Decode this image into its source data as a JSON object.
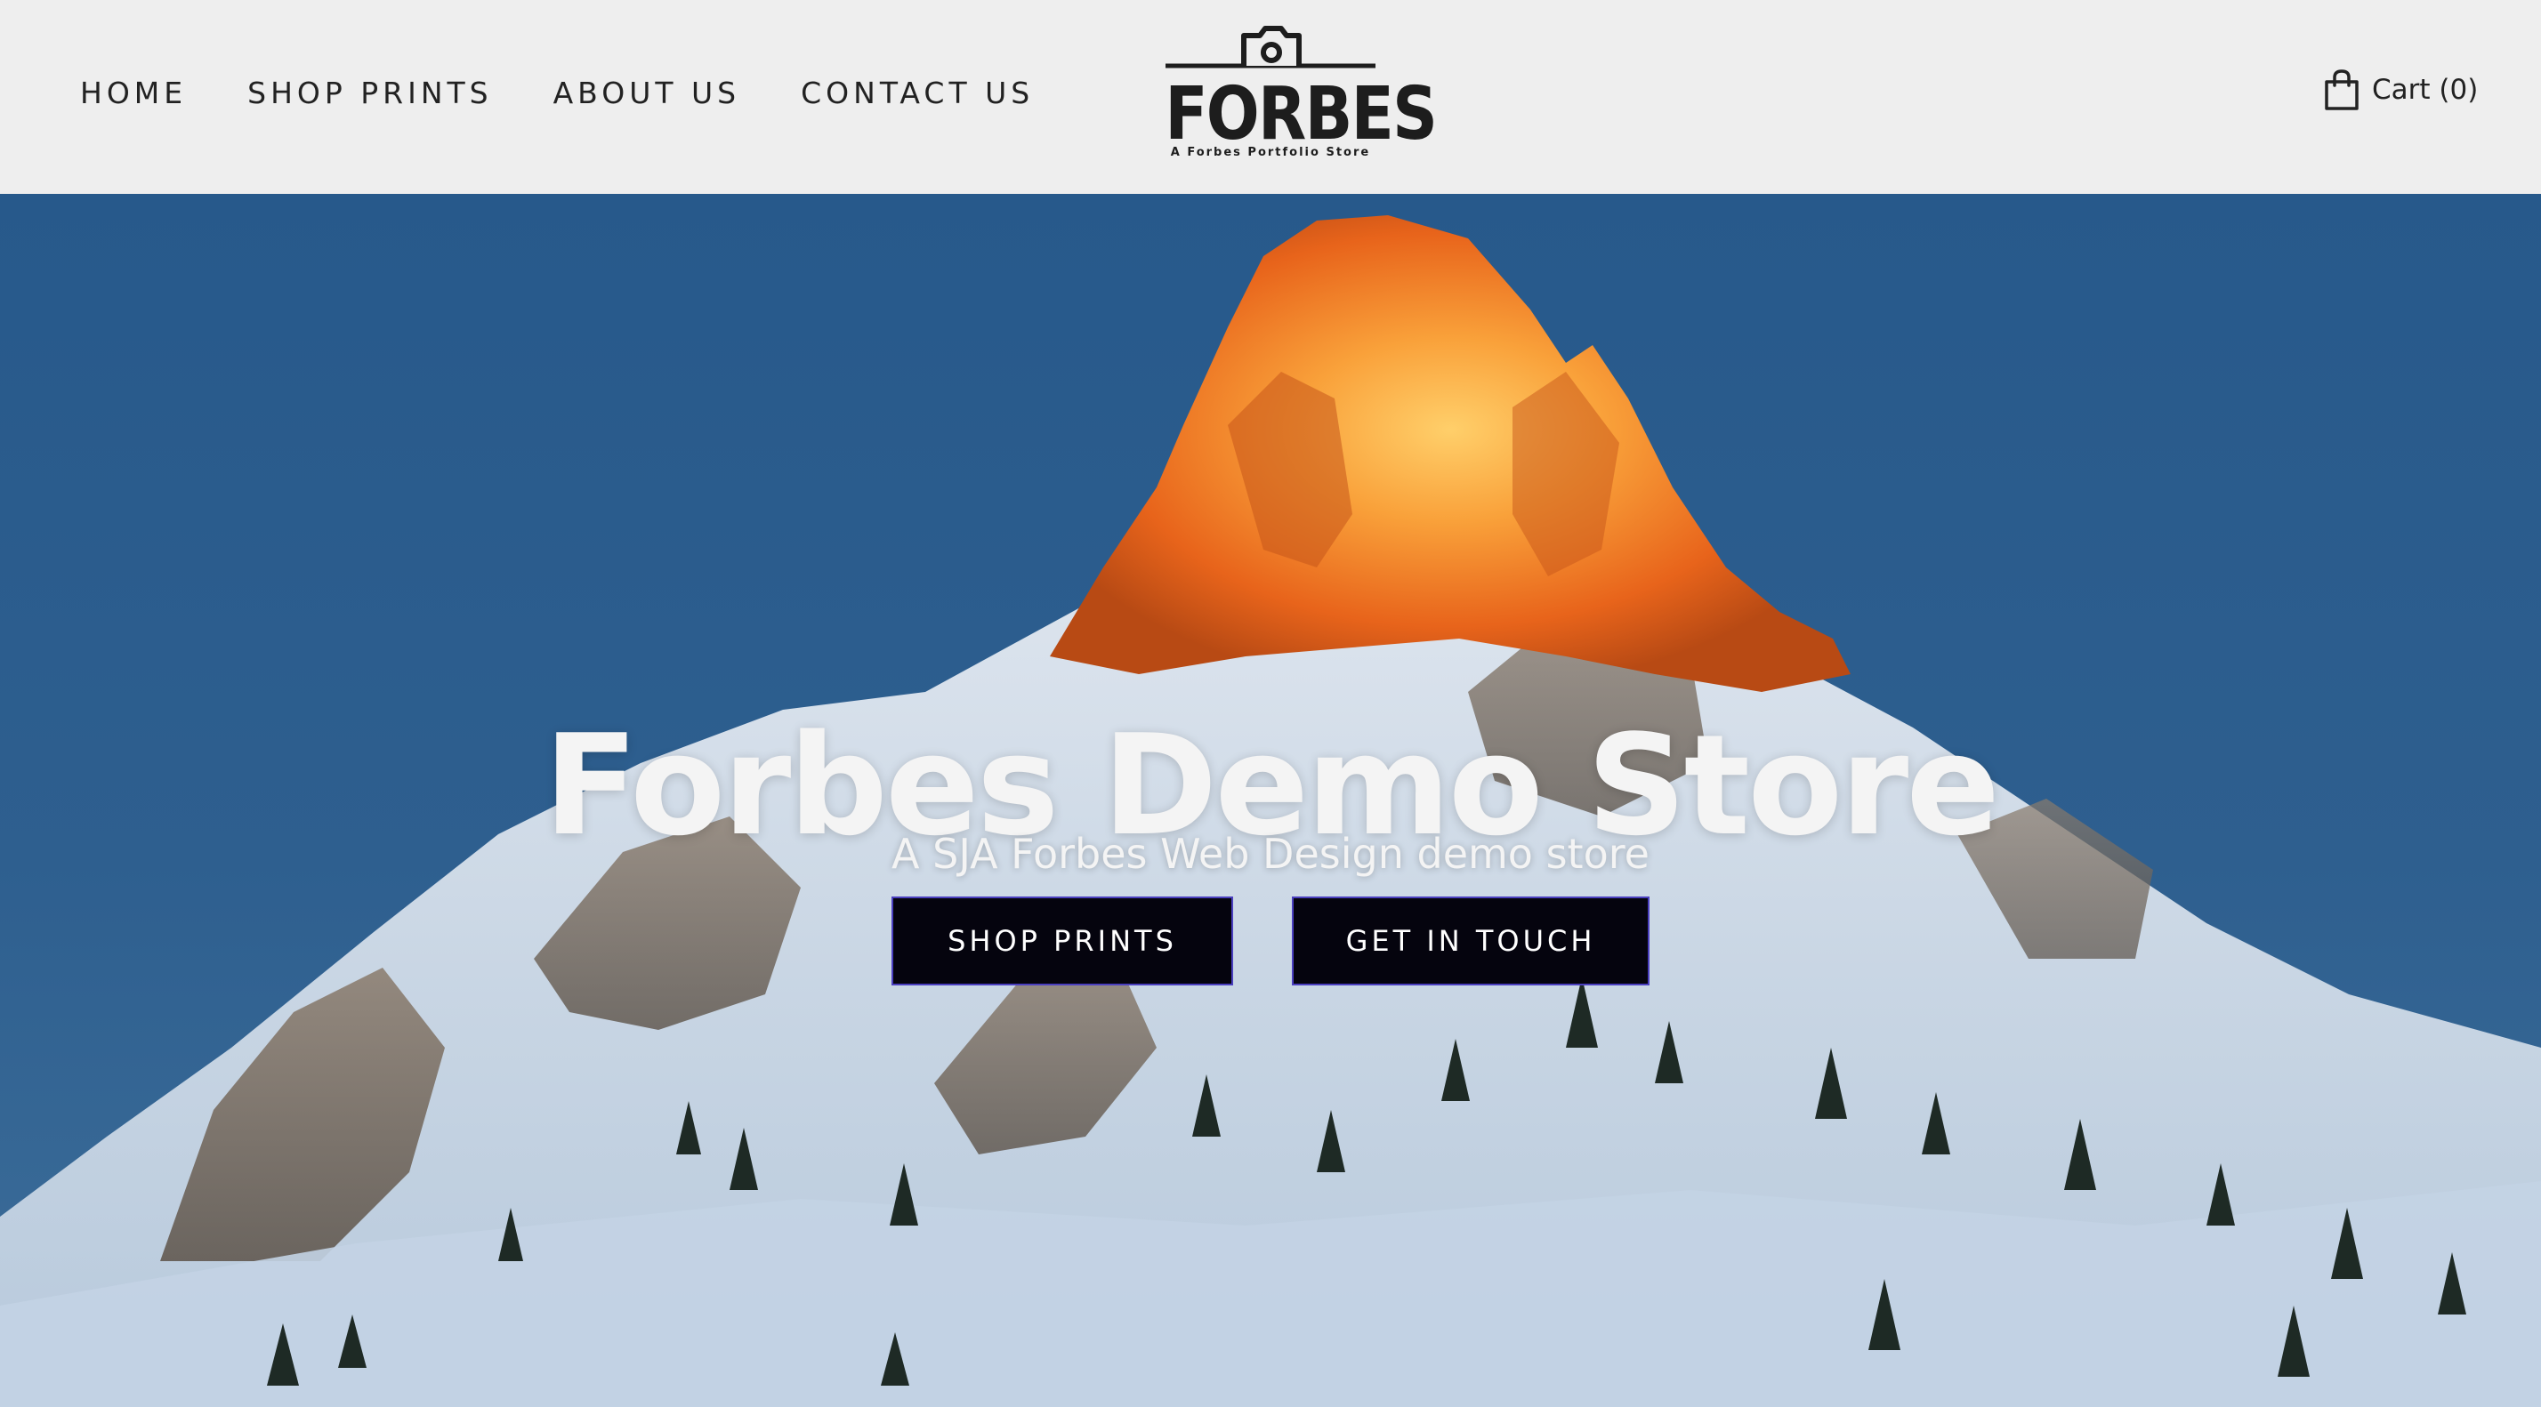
{
  "header": {
    "nav": [
      {
        "label": "HOME"
      },
      {
        "label": "SHOP PRINTS"
      },
      {
        "label": "ABOUT US"
      },
      {
        "label": "CONTACT US"
      }
    ],
    "logo": {
      "wordmark": "FORBES",
      "tagline": "A Forbes Portfolio Store"
    },
    "cart": {
      "label": "Cart (0)",
      "icon": "shopping-bag-icon"
    }
  },
  "hero": {
    "title": "Forbes Demo Store",
    "subtitle": "A SJA Forbes Web Design demo store",
    "buttons": [
      {
        "label": "SHOP PRINTS"
      },
      {
        "label": "GET IN TOUCH"
      }
    ]
  },
  "colors": {
    "header_background": "#eeeeee",
    "nav_text": "#222222",
    "button_background": "#05040e",
    "button_border": "#4a3fbf",
    "hero_text": "#f4f4f4",
    "sky": "#2c5f90",
    "peak_glow": "#f47a1f"
  }
}
